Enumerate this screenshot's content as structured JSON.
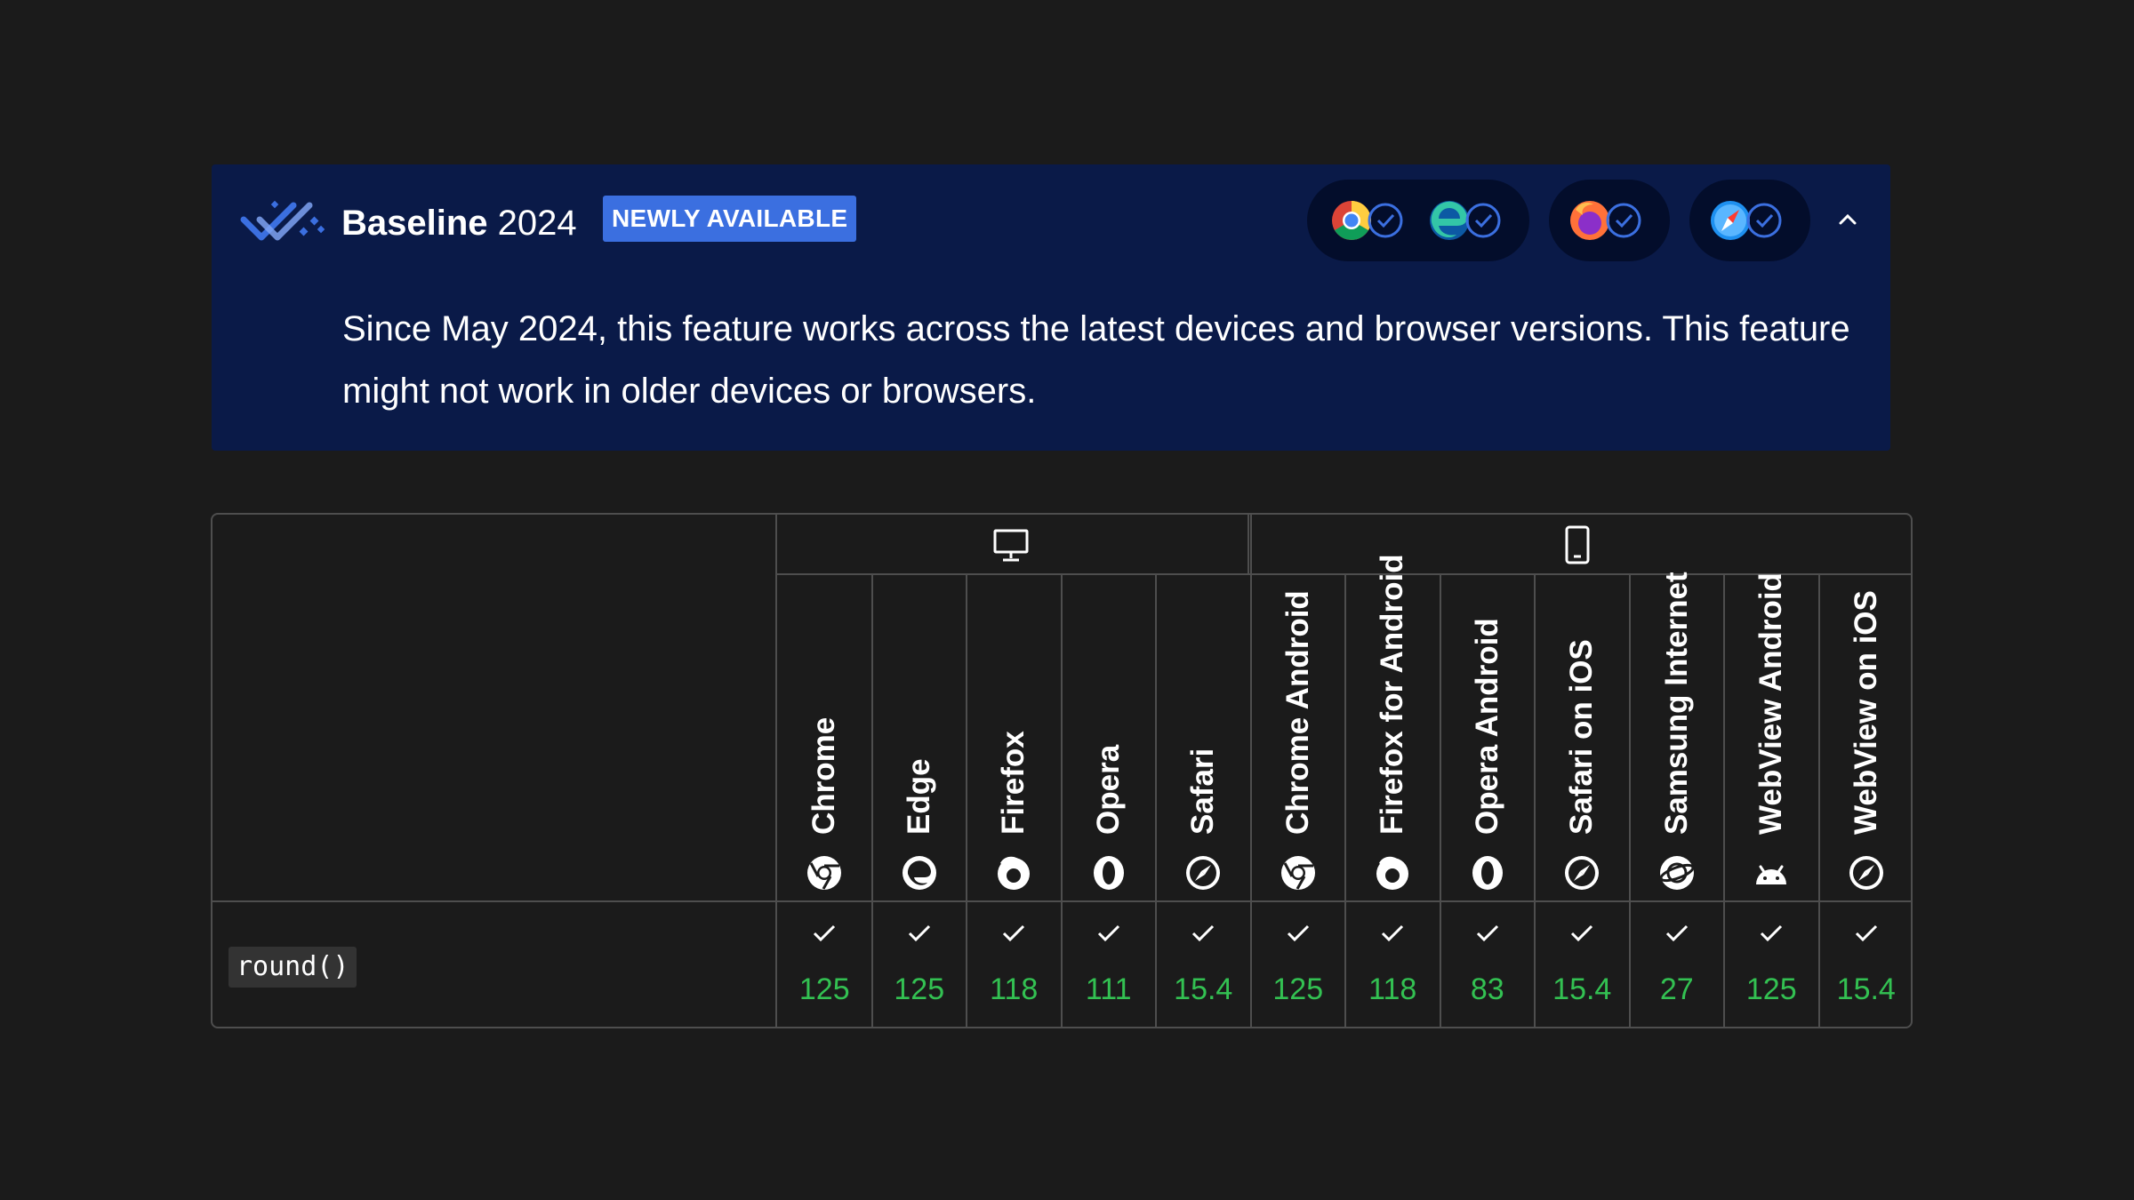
{
  "baseline": {
    "title_strong": "Baseline",
    "title_year": "2024",
    "badge": "NEWLY AVAILABLE",
    "description": "Since May 2024, this feature works across the latest devices and browser versions. This feature might not work in older devices or browsers.",
    "accent_color": "#3b6fe0",
    "engine_groups": [
      {
        "browsers": [
          "chrome-icon",
          "edge-icon"
        ],
        "status": "supported"
      },
      {
        "browsers": [
          "firefox-icon"
        ],
        "status": "supported"
      },
      {
        "browsers": [
          "safari-icon"
        ],
        "status": "supported"
      }
    ]
  },
  "table": {
    "platforms": [
      {
        "icon": "desktop-icon"
      },
      {
        "icon": "mobile-icon"
      }
    ],
    "browsers": [
      {
        "name": "Chrome",
        "icon": "chrome-icon",
        "platform": "desktop"
      },
      {
        "name": "Edge",
        "icon": "edge-icon",
        "platform": "desktop"
      },
      {
        "name": "Firefox",
        "icon": "firefox-icon",
        "platform": "desktop"
      },
      {
        "name": "Opera",
        "icon": "opera-icon",
        "platform": "desktop"
      },
      {
        "name": "Safari",
        "icon": "safari-icon",
        "platform": "desktop"
      },
      {
        "name": "Chrome Android",
        "icon": "chrome-icon",
        "platform": "mobile"
      },
      {
        "name": "Firefox for Android",
        "icon": "firefox-icon",
        "platform": "mobile"
      },
      {
        "name": "Opera Android",
        "icon": "opera-icon",
        "platform": "mobile"
      },
      {
        "name": "Safari on iOS",
        "icon": "safari-icon",
        "platform": "mobile"
      },
      {
        "name": "Samsung Internet",
        "icon": "samsung-internet-icon",
        "platform": "mobile"
      },
      {
        "name": "WebView Android",
        "icon": "android-icon",
        "platform": "mobile"
      },
      {
        "name": "WebView on iOS",
        "icon": "safari-icon",
        "platform": "mobile"
      }
    ],
    "feature": {
      "name": "round()",
      "support": [
        "125",
        "125",
        "118",
        "111",
        "15.4",
        "125",
        "118",
        "83",
        "15.4",
        "27",
        "125",
        "15.4"
      ],
      "support_color": "#33c152"
    }
  }
}
